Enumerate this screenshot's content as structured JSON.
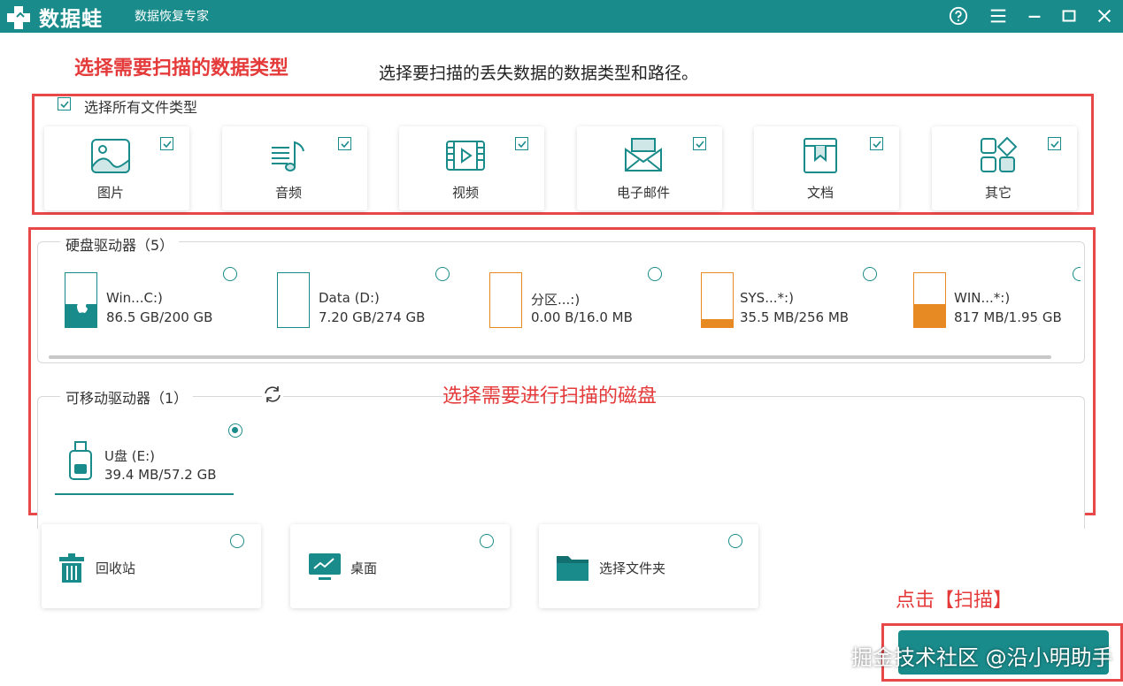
{
  "app": {
    "logo_text": "数据蛙",
    "subtitle": "数据恢复专家"
  },
  "titlebar_icons": [
    "help-icon",
    "menu-icon",
    "minimize-icon",
    "maximize-icon",
    "close-icon"
  ],
  "annotations": {
    "select_types": "选择需要扫描的数据类型",
    "select_disk": "选择需要进行扫描的磁盘",
    "click_scan": "点击【扫描】"
  },
  "instruction": "选择要扫描的丢失数据的数据类型和路径。",
  "select_all": {
    "label": "选择所有文件类型",
    "checked": true
  },
  "file_types": [
    {
      "label": "图片",
      "icon": "image-icon",
      "checked": true
    },
    {
      "label": "音频",
      "icon": "audio-icon",
      "checked": true
    },
    {
      "label": "视频",
      "icon": "video-icon",
      "checked": true
    },
    {
      "label": "电子邮件",
      "icon": "email-icon",
      "checked": true
    },
    {
      "label": "文档",
      "icon": "document-icon",
      "checked": true
    },
    {
      "label": "其它",
      "icon": "other-icon",
      "checked": true
    }
  ],
  "hard_drives": {
    "title": "硬盘驱动器（5）",
    "drives": [
      {
        "name": "Win...C:)",
        "size": "86.5 GB/200 GB",
        "used_fraction": 0.43,
        "color": "#1a8b8b",
        "icon": "windows-icon"
      },
      {
        "name": "Data (D:)",
        "size": "7.20 GB/274 GB",
        "used_fraction": 0.0,
        "color": "#1a8b8b"
      },
      {
        "name": "分区...:)",
        "size": "0.00  B/16.0 MB",
        "used_fraction": 0.0,
        "color": "#e78a24"
      },
      {
        "name": "SYS...*:)",
        "size": "35.5 MB/256 MB",
        "used_fraction": 0.14,
        "color": "#e78a24"
      },
      {
        "name": "WIN...*:)",
        "size": "817 MB/1.95 GB",
        "used_fraction": 0.42,
        "color": "#e78a24"
      }
    ]
  },
  "removable_drives": {
    "title": "可移动驱动器（1）",
    "drives": [
      {
        "name": "U盘 (E:)",
        "size": "39.4 MB/57.2 GB",
        "selected": true,
        "icon": "usb-drive-icon"
      }
    ]
  },
  "locations": [
    {
      "label": "回收站",
      "icon": "recycle-bin-icon"
    },
    {
      "label": "桌面",
      "icon": "desktop-icon"
    },
    {
      "label": "选择文件夹",
      "icon": "folder-icon"
    }
  ],
  "watermark": "掘金技术社区 @沿小明助手",
  "colors": {
    "primary": "#1a8b8b",
    "annotation": "#e53a3a",
    "partition": "#e78a24"
  }
}
